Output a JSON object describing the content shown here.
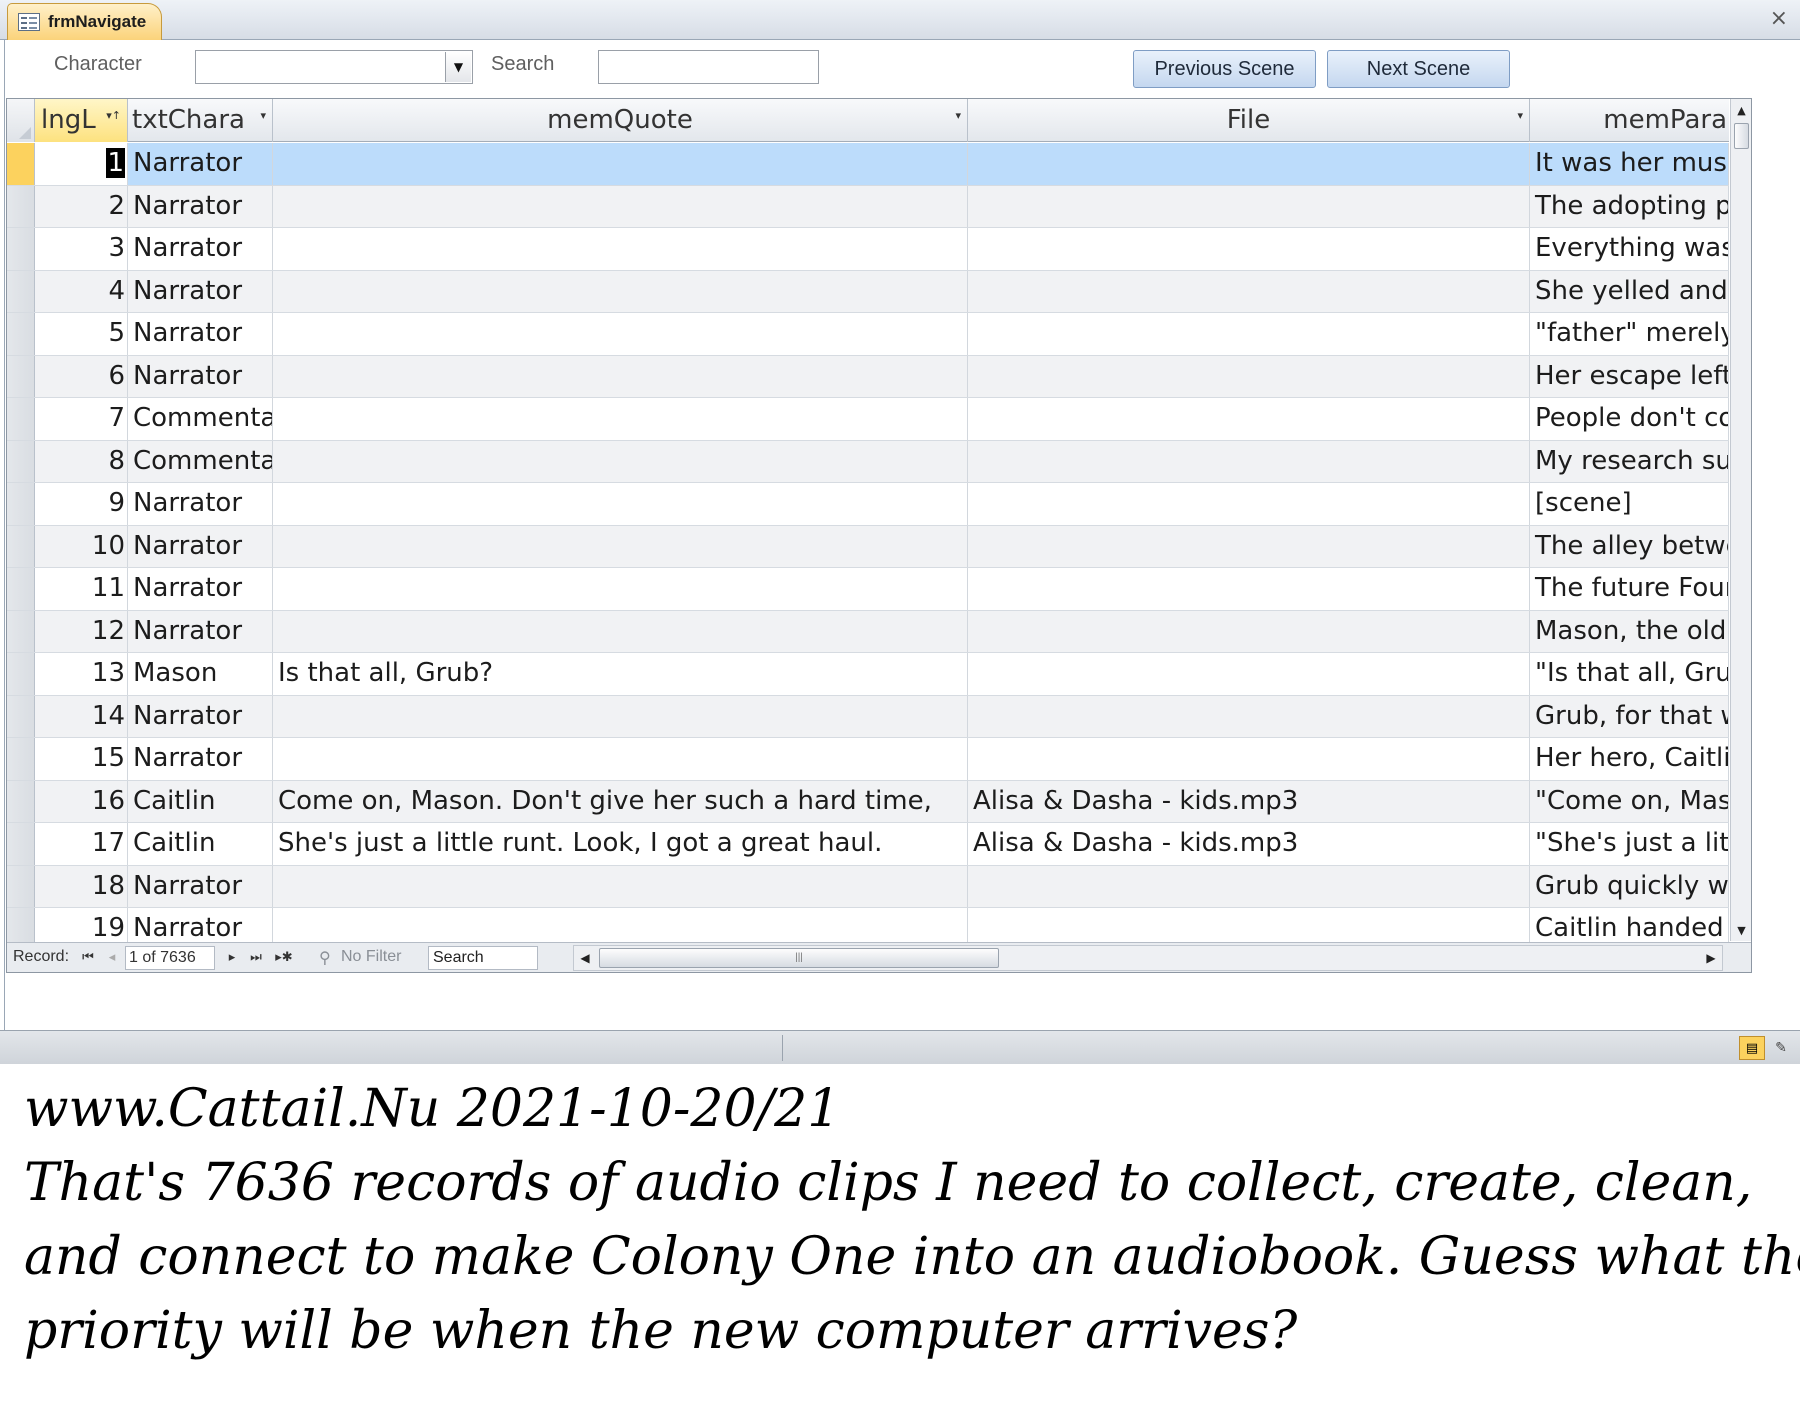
{
  "window": {
    "form_tab": "frmNavigate",
    "close_glyph": "×"
  },
  "filters": {
    "character_label": "Character",
    "character_value": "",
    "search_label": "Search",
    "search_value": "",
    "previous_button": "Previous Scene",
    "next_button": "Next Scene"
  },
  "columns": {
    "col1": "lngL",
    "col2": "txtChara",
    "col3": "memQuote",
    "col4": "File",
    "col5": "memPara"
  },
  "rows": [
    {
      "id": "1",
      "character": "Narrator",
      "quote": "",
      "file": "",
      "para": "It was her musi"
    },
    {
      "id": "2",
      "character": "Narrator",
      "quote": "",
      "file": "",
      "para": "The adopting pa"
    },
    {
      "id": "3",
      "character": "Narrator",
      "quote": "",
      "file": "",
      "para": "Everything was"
    },
    {
      "id": "4",
      "character": "Narrator",
      "quote": "",
      "file": "",
      "para": "She yelled and"
    },
    {
      "id": "5",
      "character": "Narrator",
      "quote": "",
      "file": "",
      "para": "\"father\" merely"
    },
    {
      "id": "6",
      "character": "Narrator",
      "quote": "",
      "file": "",
      "para": "Her escape left"
    },
    {
      "id": "7",
      "character": "Commenta",
      "quote": "",
      "file": "",
      "para": "People don't co"
    },
    {
      "id": "8",
      "character": "Commenta",
      "quote": "",
      "file": "",
      "para": "My research su"
    },
    {
      "id": "9",
      "character": "Narrator",
      "quote": "",
      "file": "",
      "para": "[scene]"
    },
    {
      "id": "10",
      "character": "Narrator",
      "quote": "",
      "file": "",
      "para": "The alley betwe"
    },
    {
      "id": "11",
      "character": "Narrator",
      "quote": "",
      "file": "",
      "para": "The future Four"
    },
    {
      "id": "12",
      "character": "Narrator",
      "quote": "",
      "file": "",
      "para": "Mason, the old"
    },
    {
      "id": "13",
      "character": "Mason",
      "quote": "Is that all, Grub?",
      "file": "",
      "para": "\"Is that all, Grub"
    },
    {
      "id": "14",
      "character": "Narrator",
      "quote": "",
      "file": "",
      "para": "Grub, for that w"
    },
    {
      "id": "15",
      "character": "Narrator",
      "quote": "",
      "file": "",
      "para": "Her hero, Caitlin"
    },
    {
      "id": "16",
      "character": "Caitlin",
      "quote": "Come on, Mason.  Don't give her such a hard time,",
      "file": "Alisa & Dasha - kids.mp3",
      "para": "\"Come on, Mas"
    },
    {
      "id": "17",
      "character": "Caitlin",
      "quote": "She's just a little runt.  Look, I got a great haul.",
      "file": "Alisa & Dasha - kids.mp3",
      "para": "\"She's just a litt"
    },
    {
      "id": "18",
      "character": "Narrator",
      "quote": "",
      "file": "",
      "para": "Grub quickly wi"
    },
    {
      "id": "19",
      "character": "Narrator",
      "quote": "",
      "file": "",
      "para": "Caitlin handed"
    }
  ],
  "navigation": {
    "record_label": "Record:",
    "record_position": "1 of 7636",
    "filter_label": "No Filter",
    "search_label": "Search",
    "first_glyph": "⏮",
    "prev_glyph": "◂",
    "next_glyph": "▸",
    "last_glyph": "⏭",
    "new_glyph": "▸✱",
    "scroll_left": "◀",
    "scroll_right": "▶",
    "scroll_grip": "|||"
  },
  "caption": {
    "line1": "www.Cattail.Nu   2021-10-20/21",
    "line2": "That's 7636 records of audio clips I need to collect, create, clean,",
    "line3": "and connect to make Colony One into an audiobook. Guess what the",
    "line4": "priority will be when the new computer arrives?"
  },
  "icons": {
    "form_tab_icon": "form-icon",
    "dropdown": "chevron-down-icon",
    "sort": "sort-arrow-icon",
    "filter": "filter-icon",
    "datasheet_view": "datasheet-view-icon",
    "design_view": "design-view-icon"
  },
  "colors": {
    "selected_row": "#bcdcfb",
    "record_selector_active": "#fcd25e",
    "alt_row": "#f1f2f4",
    "button_gradient_bottom": "#c4d7ef"
  }
}
